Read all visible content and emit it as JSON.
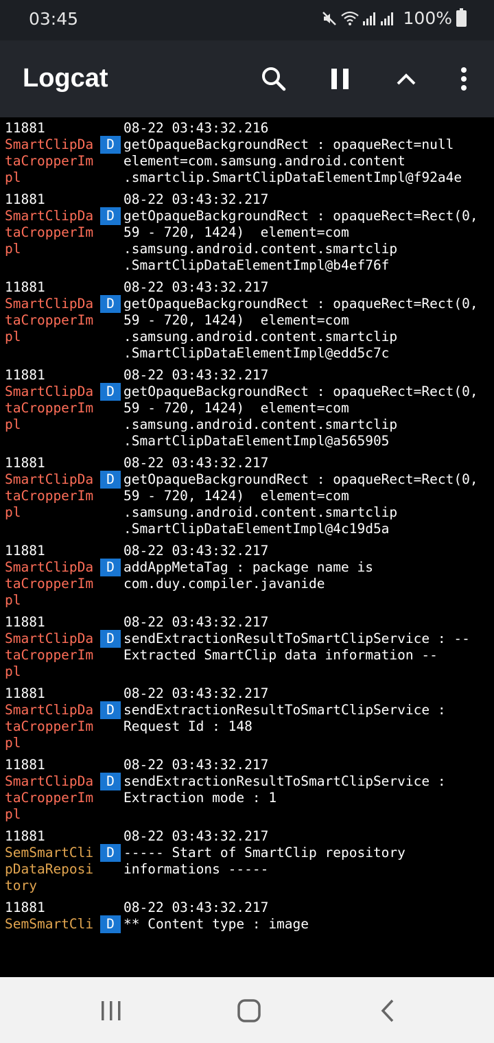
{
  "status_bar": {
    "time": "03:45",
    "battery": "100%",
    "icons": [
      "mute-icon",
      "wifi-icon",
      "signal-icon",
      "signal-icon",
      "battery-icon"
    ]
  },
  "app_bar": {
    "title": "Logcat",
    "actions": [
      "search-icon",
      "pause-icon",
      "chevron-up-icon",
      "more-vert-icon"
    ]
  },
  "log_entries": [
    {
      "pid": "11881",
      "time": "08-22 03:43:32.216",
      "level": "D",
      "tag": [
        "SmartClipDa",
        "taCropperIm",
        "pl"
      ],
      "msg": [
        "getOpaqueBackgroundRect : opaqueRect=null",
        "element=com.samsung.android.content",
        ".smartclip.SmartClipDataElementImpl@f92a4e"
      ]
    },
    {
      "pid": "11881",
      "time": "08-22 03:43:32.217",
      "level": "D",
      "tag": [
        "SmartClipDa",
        "taCropperIm",
        "pl"
      ],
      "msg": [
        "getOpaqueBackgroundRect : opaqueRect=Rect(0,",
        "59 - 720, 1424)  element=com",
        ".samsung.android.content.smartclip",
        ".SmartClipDataElementImpl@b4ef76f"
      ]
    },
    {
      "pid": "11881",
      "time": "08-22 03:43:32.217",
      "level": "D",
      "tag": [
        "SmartClipDa",
        "taCropperIm",
        "pl"
      ],
      "msg": [
        "getOpaqueBackgroundRect : opaqueRect=Rect(0,",
        "59 - 720, 1424)  element=com",
        ".samsung.android.content.smartclip",
        ".SmartClipDataElementImpl@edd5c7c"
      ]
    },
    {
      "pid": "11881",
      "time": "08-22 03:43:32.217",
      "level": "D",
      "tag": [
        "SmartClipDa",
        "taCropperIm",
        "pl"
      ],
      "msg": [
        "getOpaqueBackgroundRect : opaqueRect=Rect(0,",
        "59 - 720, 1424)  element=com",
        ".samsung.android.content.smartclip",
        ".SmartClipDataElementImpl@a565905"
      ]
    },
    {
      "pid": "11881",
      "time": "08-22 03:43:32.217",
      "level": "D",
      "tag": [
        "SmartClipDa",
        "taCropperIm",
        "pl"
      ],
      "msg": [
        "getOpaqueBackgroundRect : opaqueRect=Rect(0,",
        "59 - 720, 1424)  element=com",
        ".samsung.android.content.smartclip",
        ".SmartClipDataElementImpl@4c19d5a"
      ]
    },
    {
      "pid": "11881",
      "time": "08-22 03:43:32.217",
      "level": "D",
      "tag": [
        "SmartClipDa",
        "taCropperIm",
        "pl"
      ],
      "msg": [
        "addAppMetaTag : package name is",
        "com.duy.compiler.javanide"
      ]
    },
    {
      "pid": "11881",
      "time": "08-22 03:43:32.217",
      "level": "D",
      "tag": [
        "SmartClipDa",
        "taCropperIm",
        "pl"
      ],
      "msg": [
        "sendExtractionResultToSmartClipService : --",
        "Extracted SmartClip data information --"
      ]
    },
    {
      "pid": "11881",
      "time": "08-22 03:43:32.217",
      "level": "D",
      "tag": [
        "SmartClipDa",
        "taCropperIm",
        "pl"
      ],
      "msg": [
        "sendExtractionResultToSmartClipService :",
        "Request Id : 148"
      ]
    },
    {
      "pid": "11881",
      "time": "08-22 03:43:32.217",
      "level": "D",
      "tag": [
        "SmartClipDa",
        "taCropperIm",
        "pl"
      ],
      "msg": [
        "sendExtractionResultToSmartClipService :",
        "Extraction mode : 1"
      ]
    },
    {
      "pid": "11881",
      "time": "08-22 03:43:32.217",
      "level": "D",
      "tag": [
        "SemSmartCli",
        "pDataReposi",
        "tory"
      ],
      "tag_color": "#e2a54f",
      "msg": [
        "----- Start of SmartClip repository",
        "informations -----"
      ]
    },
    {
      "pid": "11881",
      "time": "08-22 03:43:32.217",
      "level": "D",
      "tag": [
        "SemSmartCli"
      ],
      "tag_color": "#e2a54f",
      "msg": [
        "** Content type : image"
      ]
    }
  ],
  "nav_bar": {
    "buttons": [
      "recent-apps-icon",
      "home-icon",
      "back-icon"
    ]
  },
  "colors": {
    "tag_default": "#ff6e58",
    "tag_repository": "#e2a54f",
    "level_debug": "#1976d2"
  }
}
